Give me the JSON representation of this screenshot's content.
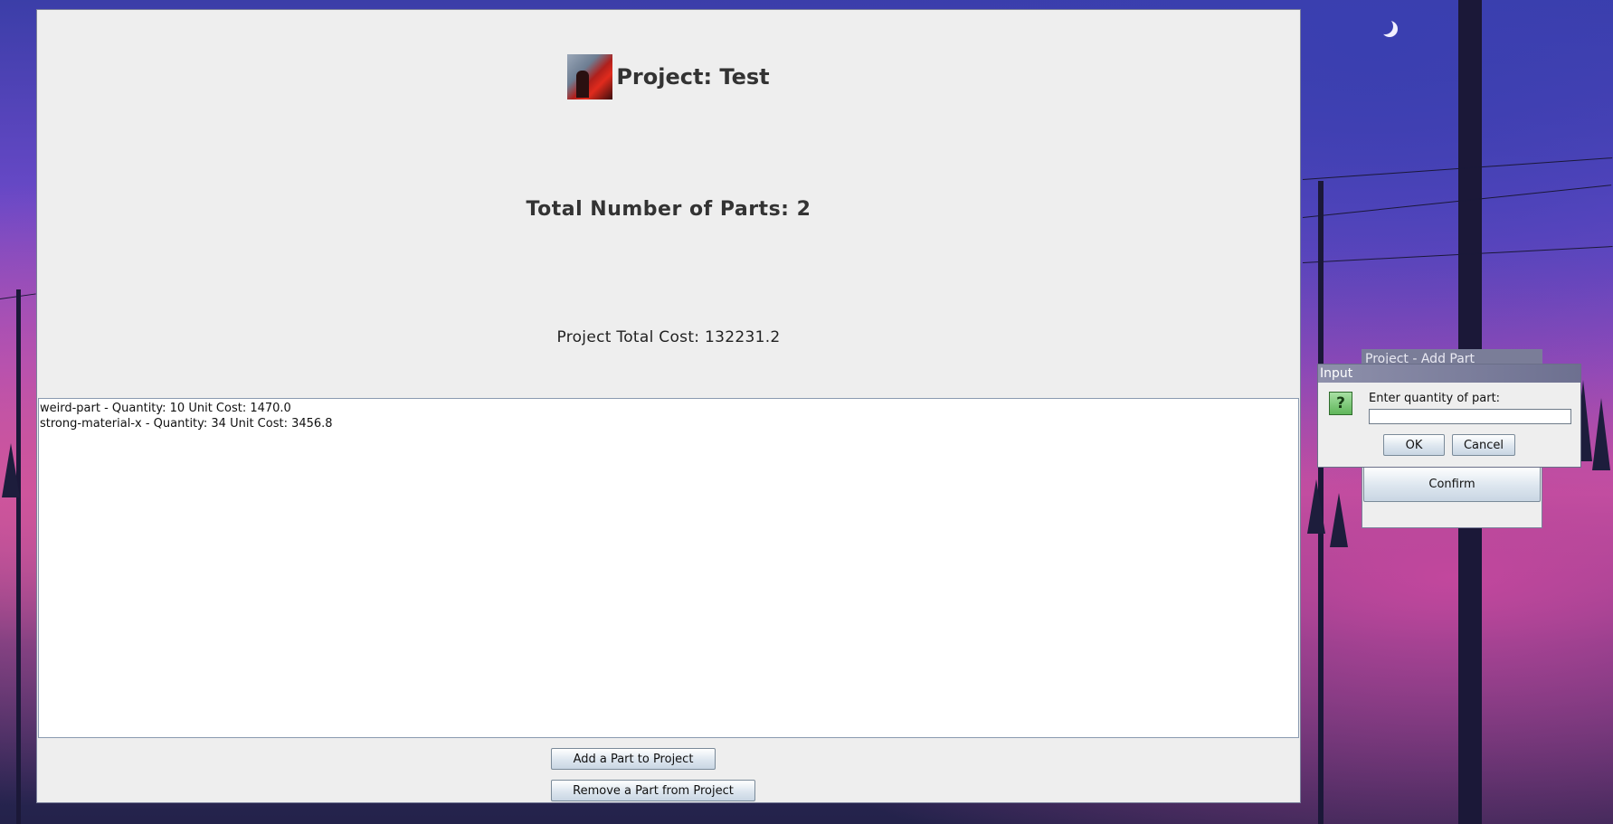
{
  "main": {
    "project_title": "Project: Test",
    "total_parts": "Total Number of Parts: 2",
    "total_cost": "Project Total Cost: 132231.2",
    "parts": [
      "weird-part - Quantity: 10 Unit Cost: 1470.0",
      "strong-material-x - Quantity: 34 Unit Cost: 3456.8"
    ],
    "add_button_label": "Add a Part to Project",
    "remove_button_label": "Remove a Part from Project"
  },
  "add_part_window": {
    "title": "Project - Add Part",
    "confirm_label": "Confirm"
  },
  "input_dialog": {
    "title": "Input",
    "icon_glyph": "?",
    "icon_name": "question-icon",
    "message": "Enter quantity of part:",
    "input_value": "",
    "ok_label": "OK",
    "cancel_label": "Cancel"
  }
}
